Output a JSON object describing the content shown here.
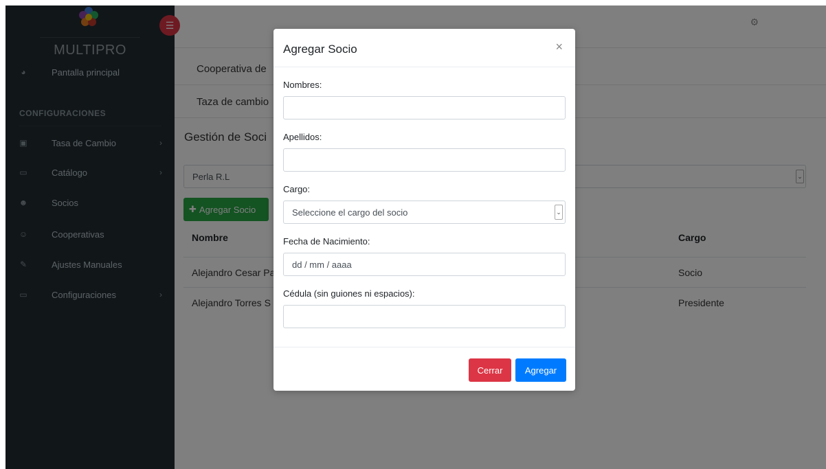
{
  "brand": {
    "name": "MULTIPRO"
  },
  "sidebar": {
    "items": [
      {
        "label": "Pantalla principal",
        "icon": "dashboard-icon"
      },
      {
        "label": "Tasa de Cambio",
        "icon": "money-icon",
        "has_submenu": true
      },
      {
        "label": "Catálogo",
        "icon": "laptop-icon",
        "has_submenu": true
      },
      {
        "label": "Socios",
        "icon": "users-icon"
      },
      {
        "label": "Cooperativas",
        "icon": "user-plus-icon"
      },
      {
        "label": "Ajustes Manuales",
        "icon": "wrench-icon"
      },
      {
        "label": "Configuraciones",
        "icon": "laptop-icon",
        "has_submenu": true
      }
    ],
    "section_label": "CONFIGURACIONES"
  },
  "main": {
    "card1": "Cooperativa de",
    "card2": "Taza de cambio",
    "section_title": "Gestión de Soci",
    "cooperativa_select": "Perla R.L",
    "add_button": "Agregar Socio",
    "table": {
      "headers": [
        "Nombre",
        "Cargo"
      ],
      "rows": [
        {
          "nombre": "Alejandro Cesar Pa",
          "cargo": "Socio"
        },
        {
          "nombre": "Alejandro Torres S",
          "cargo": "Presidente"
        }
      ]
    }
  },
  "modal": {
    "title": "Agregar Socio",
    "close": "×",
    "fields": {
      "nombres_label": "Nombres:",
      "nombres_value": "",
      "apellidos_label": "Apellidos:",
      "apellidos_value": "",
      "cargo_label": "Cargo:",
      "cargo_value": "Seleccione el cargo del socio",
      "fecha_label": "Fecha de Nacimiento:",
      "fecha_placeholder": "dd / mm / aaaa",
      "cedula_label": "Cédula (sin guiones ni espacios):",
      "cedula_value": ""
    },
    "buttons": {
      "cerrar": "Cerrar",
      "agregar": "Agregar"
    }
  },
  "colors": {
    "sidebar_bg": "#222d32",
    "danger": "#dc3545",
    "primary": "#007bff",
    "success": "#28a745"
  }
}
